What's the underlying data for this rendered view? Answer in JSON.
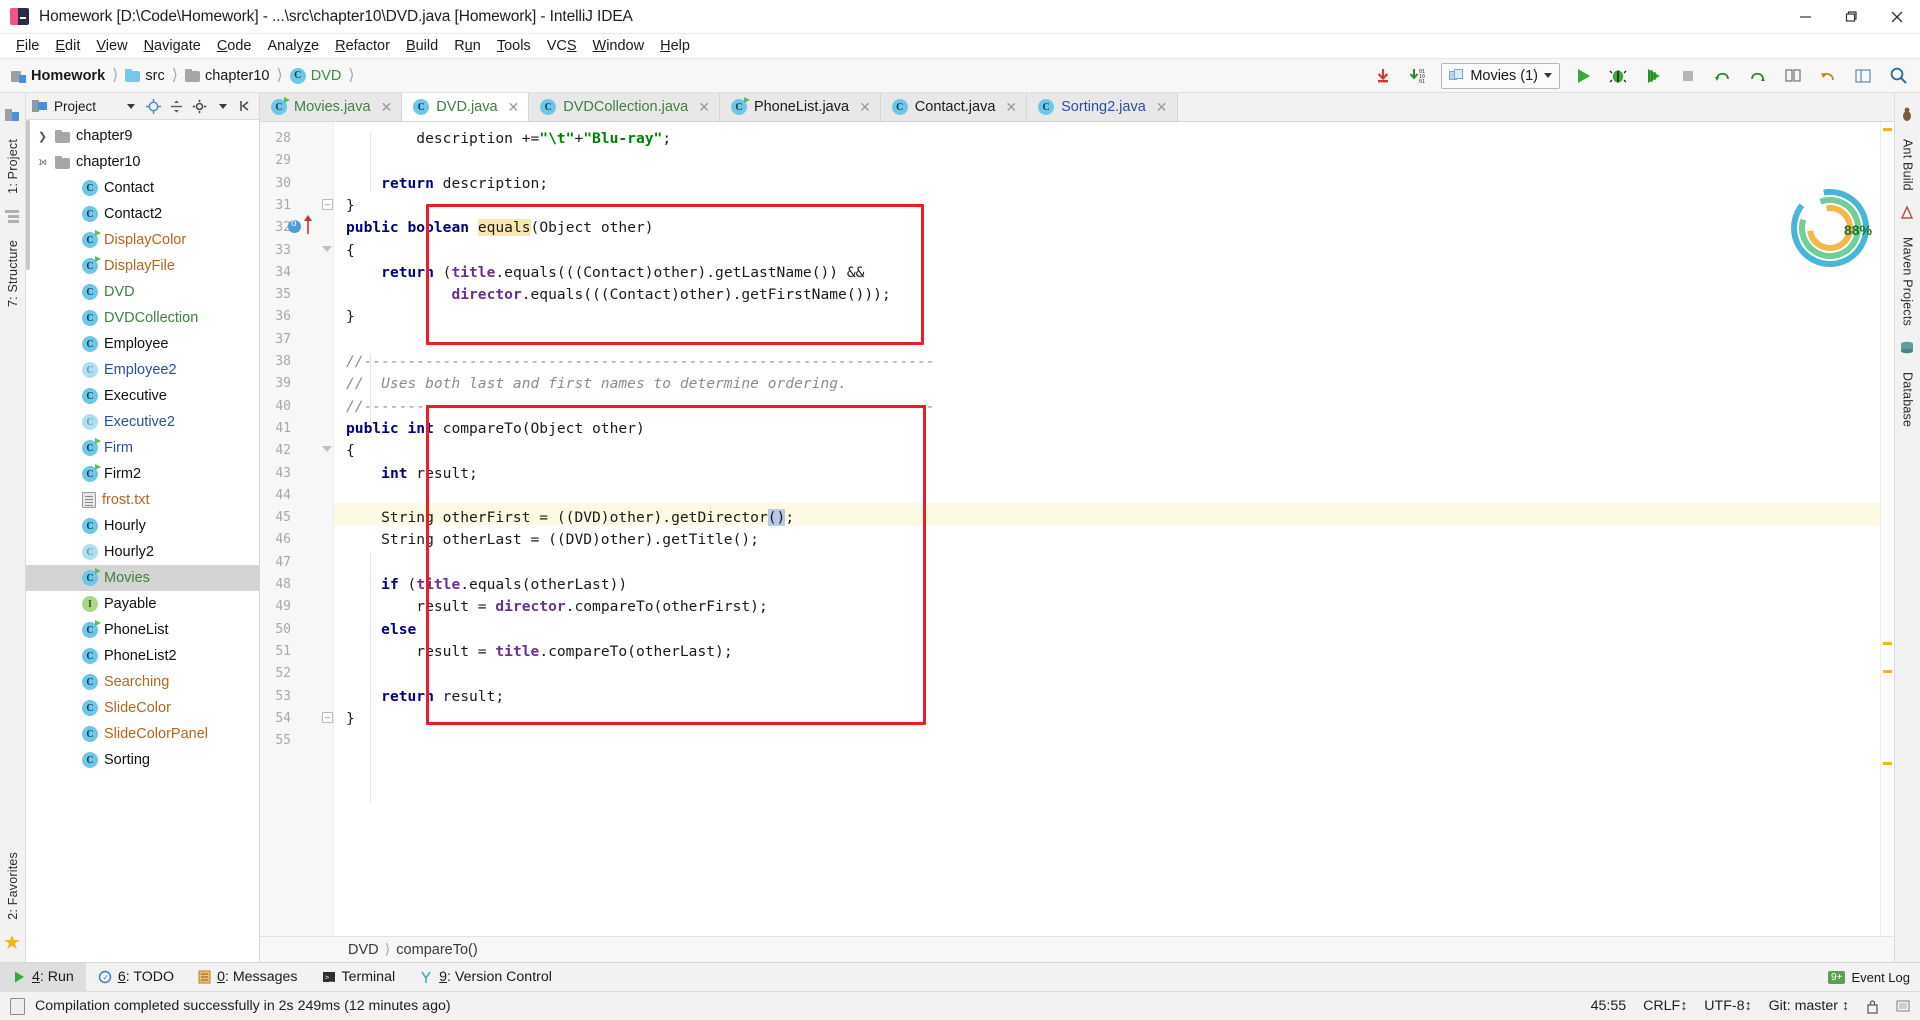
{
  "window": {
    "title": "Homework [D:\\Code\\Homework] - ...\\src\\chapter10\\DVD.java [Homework] - IntelliJ IDEA",
    "minimize_label": "minimize-icon",
    "maximize_label": "restore-icon",
    "close_label": "close-icon"
  },
  "menu": [
    {
      "label": "File"
    },
    {
      "label": "Edit"
    },
    {
      "label": "View"
    },
    {
      "label": "Navigate"
    },
    {
      "label": "Code"
    },
    {
      "label": "Analyze"
    },
    {
      "label": "Refactor"
    },
    {
      "label": "Build"
    },
    {
      "label": "Run"
    },
    {
      "label": "Tools"
    },
    {
      "label": "VCS"
    },
    {
      "label": "Window"
    },
    {
      "label": "Help"
    }
  ],
  "navbar": {
    "crumbs": [
      {
        "label": "Homework",
        "icon": "module-icon",
        "style": "bold"
      },
      {
        "label": "src",
        "icon": "folder-icon",
        "style": "plain"
      },
      {
        "label": "chapter10",
        "icon": "folder-grey-icon",
        "style": "plain"
      },
      {
        "label": "DVD",
        "icon": "class-icon",
        "style": "green"
      }
    ],
    "run_config": "Movies (1)",
    "actions": [
      "update-project-icon",
      "commit-icon",
      "run-icon",
      "debug-icon",
      "coverage-icon",
      "stop-icon",
      "vcs-update-icon",
      "vcs-commit-icon",
      "vcs-diff-icon",
      "undo-icon",
      "layout-icon",
      "search-everywhere-icon"
    ]
  },
  "left_rail": [
    {
      "label": "1: Project"
    },
    {
      "label": "7: Structure"
    },
    {
      "label": "2: Favorites"
    }
  ],
  "right_rail": [
    {
      "label": "Ant Build"
    },
    {
      "label": "Maven Projects"
    },
    {
      "label": "Database"
    }
  ],
  "project_panel": {
    "title": "Project",
    "header_icons": [
      "project-view-icon",
      "chevron-down-icon",
      "locate-icon",
      "collapse-all-icon",
      "gear-icon",
      "hide-icon"
    ],
    "tree": [
      {
        "label": "chapter9",
        "icon": "folder-grey-icon",
        "indent": 0,
        "arrow": "right",
        "color": "dark",
        "selected": false
      },
      {
        "label": "chapter10",
        "icon": "folder-grey-icon",
        "indent": 0,
        "arrow": "down",
        "color": "dark",
        "selected": false
      },
      {
        "label": "Contact",
        "icon": "class-icon",
        "indent": 1,
        "arrow": "",
        "color": "dark",
        "selected": false
      },
      {
        "label": "Contact2",
        "icon": "class-icon",
        "indent": 1,
        "arrow": "",
        "color": "dark",
        "selected": false
      },
      {
        "label": "DisplayColor",
        "icon": "class-mod-icon",
        "indent": 1,
        "arrow": "",
        "color": "orange",
        "selected": false
      },
      {
        "label": "DisplayFile",
        "icon": "class-mod-icon",
        "indent": 1,
        "arrow": "",
        "color": "orange",
        "selected": false
      },
      {
        "label": "DVD",
        "icon": "class-icon",
        "indent": 1,
        "arrow": "",
        "color": "green",
        "selected": false
      },
      {
        "label": "DVDCollection",
        "icon": "class-icon",
        "indent": 1,
        "arrow": "",
        "color": "green",
        "selected": false
      },
      {
        "label": "Employee",
        "icon": "class-icon",
        "indent": 1,
        "arrow": "",
        "color": "dark",
        "selected": false
      },
      {
        "label": "Employee2",
        "icon": "class-faded-icon",
        "indent": 1,
        "arrow": "",
        "color": "blue",
        "selected": false
      },
      {
        "label": "Executive",
        "icon": "class-icon",
        "indent": 1,
        "arrow": "",
        "color": "dark",
        "selected": false
      },
      {
        "label": "Executive2",
        "icon": "class-faded-icon",
        "indent": 1,
        "arrow": "",
        "color": "blue",
        "selected": false
      },
      {
        "label": "Firm",
        "icon": "class-mod-icon",
        "indent": 1,
        "arrow": "",
        "color": "blue",
        "selected": false
      },
      {
        "label": "Firm2",
        "icon": "class-mod-icon",
        "indent": 1,
        "arrow": "",
        "color": "dark",
        "selected": false
      },
      {
        "label": "frost.txt",
        "icon": "text-file-icon",
        "indent": 1,
        "arrow": "",
        "color": "orange",
        "selected": false
      },
      {
        "label": "Hourly",
        "icon": "class-icon",
        "indent": 1,
        "arrow": "",
        "color": "dark",
        "selected": false
      },
      {
        "label": "Hourly2",
        "icon": "class-faded-icon",
        "indent": 1,
        "arrow": "",
        "color": "dark",
        "selected": false
      },
      {
        "label": "Movies",
        "icon": "class-mod-icon",
        "indent": 1,
        "arrow": "",
        "color": "green",
        "selected": true
      },
      {
        "label": "Payable",
        "icon": "interface-icon",
        "indent": 1,
        "arrow": "",
        "color": "dark",
        "selected": false
      },
      {
        "label": "PhoneList",
        "icon": "class-mod-icon",
        "indent": 1,
        "arrow": "",
        "color": "dark",
        "selected": false
      },
      {
        "label": "PhoneList2",
        "icon": "class-icon",
        "indent": 1,
        "arrow": "",
        "color": "dark",
        "selected": false
      },
      {
        "label": "Searching",
        "icon": "class-icon",
        "indent": 1,
        "arrow": "",
        "color": "orange",
        "selected": false
      },
      {
        "label": "SlideColor",
        "icon": "class-icon",
        "indent": 1,
        "arrow": "",
        "color": "orange",
        "selected": false
      },
      {
        "label": "SlideColorPanel",
        "icon": "class-icon",
        "indent": 1,
        "arrow": "",
        "color": "orange",
        "selected": false
      },
      {
        "label": "Sorting",
        "icon": "class-icon",
        "indent": 1,
        "arrow": "",
        "color": "dark",
        "selected": false
      }
    ]
  },
  "editor_tabs": [
    {
      "label": "Movies.java",
      "color": "green",
      "active": false,
      "modified": true
    },
    {
      "label": "DVD.java",
      "color": "green",
      "active": true,
      "modified": false
    },
    {
      "label": "DVDCollection.java",
      "color": "green",
      "active": false,
      "modified": false
    },
    {
      "label": "PhoneList.java",
      "color": "dark",
      "active": false,
      "modified": true
    },
    {
      "label": "Contact.java",
      "color": "dark",
      "active": false,
      "modified": false
    },
    {
      "label": "Sorting2.java",
      "color": "blue",
      "active": false,
      "modified": false
    }
  ],
  "editor": {
    "first_line_number": 28,
    "last_line_number": 55,
    "highlighted_line": 45,
    "breakpoint_line": 32,
    "lines": [
      {
        "n": 28,
        "text": "        description +=\"\\t\"+\"Blu-ray\";"
      },
      {
        "n": 29,
        "text": ""
      },
      {
        "n": 30,
        "text": "    return description;"
      },
      {
        "n": 31,
        "text": "}"
      },
      {
        "n": 32,
        "text": "public boolean equals(Object other)"
      },
      {
        "n": 33,
        "text": "{"
      },
      {
        "n": 34,
        "text": "    return (title.equals(((Contact)other).getLastName()) &&"
      },
      {
        "n": 35,
        "text": "            director.equals(((Contact)other).getFirstName()));"
      },
      {
        "n": 36,
        "text": "}"
      },
      {
        "n": 37,
        "text": ""
      },
      {
        "n": 38,
        "text": "//-----------------------------------------------------------------"
      },
      {
        "n": 39,
        "text": "//  Uses both last and first names to determine ordering."
      },
      {
        "n": 40,
        "text": "//-----------------------------------------------------------------"
      },
      {
        "n": 41,
        "text": "public int compareTo(Object other)"
      },
      {
        "n": 42,
        "text": "{"
      },
      {
        "n": 43,
        "text": "    int result;"
      },
      {
        "n": 44,
        "text": ""
      },
      {
        "n": 45,
        "text": "    String otherFirst = ((DVD)other).getDirector();"
      },
      {
        "n": 46,
        "text": "    String otherLast = ((DVD)other).getTitle();"
      },
      {
        "n": 47,
        "text": ""
      },
      {
        "n": 48,
        "text": "    if (title.equals(otherLast))"
      },
      {
        "n": 49,
        "text": "        result = director.compareTo(otherFirst);"
      },
      {
        "n": 50,
        "text": "    else"
      },
      {
        "n": 51,
        "text": "        result = title.compareTo(otherLast);"
      },
      {
        "n": 52,
        "text": ""
      },
      {
        "n": 53,
        "text": "    return result;"
      },
      {
        "n": 54,
        "text": "}"
      },
      {
        "n": 55,
        "text": ""
      }
    ],
    "inspection_percent": "88%",
    "breadcrumb": [
      "DVD",
      "compareTo()"
    ]
  },
  "bottom_tools": [
    {
      "label": "4: Run",
      "icon": "run-icon",
      "active": true
    },
    {
      "label": "6: TODO",
      "icon": "todo-icon",
      "active": false
    },
    {
      "label": "0: Messages",
      "icon": "message-icon",
      "active": false
    },
    {
      "label": "Terminal",
      "icon": "terminal-icon",
      "active": false
    },
    {
      "label": "9: Version Control",
      "icon": "vcs-icon",
      "active": false
    }
  ],
  "event_log": {
    "label": "Event Log",
    "badge": "9+"
  },
  "status": {
    "message": "Compilation completed successfully in 2s 249ms (12 minutes ago)",
    "caret": "45:55",
    "line_separator": "CRLF",
    "encoding": "UTF-8",
    "branch": "Git: master"
  },
  "colors": {
    "accent_red": "#ee1c25",
    "keyword_blue": "#000080",
    "string_green": "#008000",
    "field_purple": "#6b2f8f",
    "comment_grey": "#8c8c8c",
    "selection_blue": "#b9c9e6",
    "highlight_yellow": "#fcfae2",
    "tab_active": "#ffffff"
  }
}
